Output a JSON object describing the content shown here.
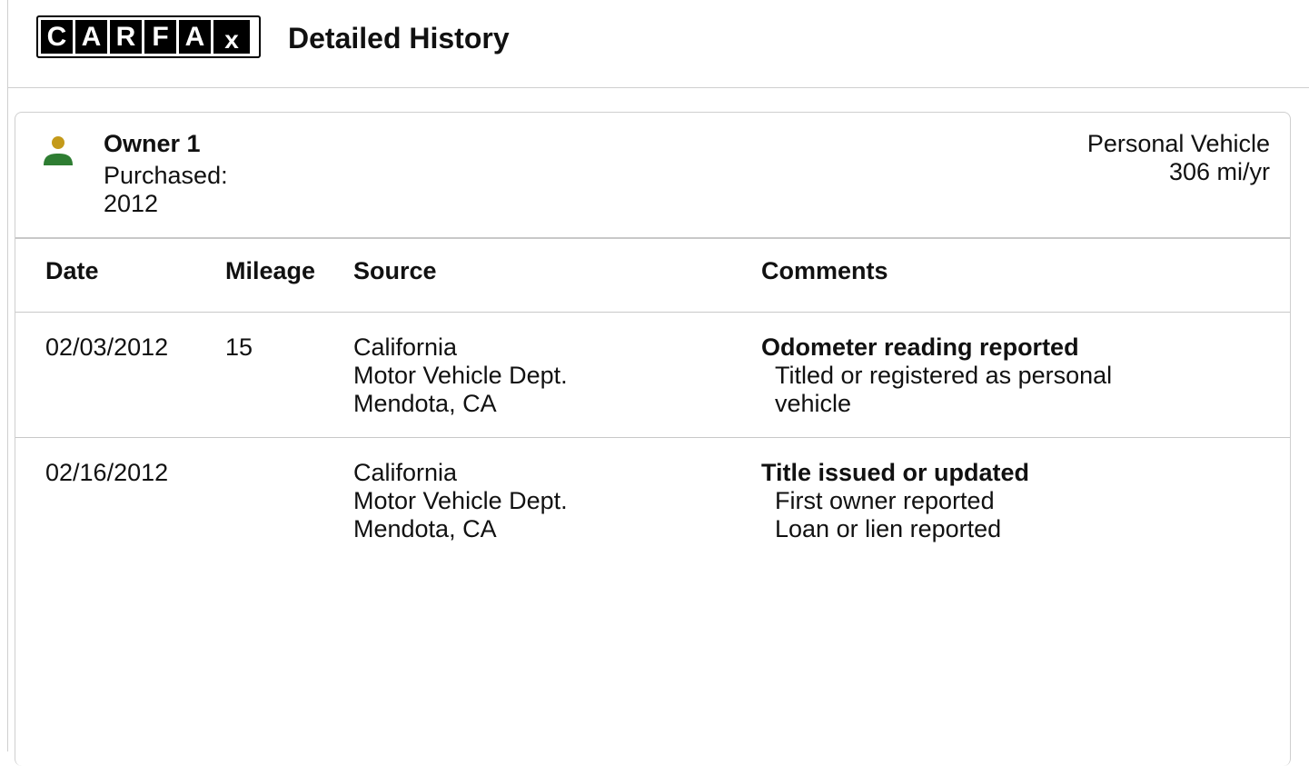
{
  "header": {
    "logo_letters": [
      "C",
      "A",
      "R",
      "F",
      "A",
      "X"
    ],
    "title": "Detailed History"
  },
  "owner": {
    "icon": "person-icon",
    "icon_head_color": "#c49a1a",
    "icon_body_color": "#2e7d32",
    "name": "Owner 1",
    "purchased_label": "Purchased:",
    "purchased_year": "2012",
    "vehicle_type": "Personal Vehicle",
    "mileage_per_year": "306 mi/yr"
  },
  "table": {
    "headers": {
      "date": "Date",
      "mileage": "Mileage",
      "source": "Source",
      "comments": "Comments"
    },
    "rows": [
      {
        "date": "02/03/2012",
        "mileage": "15",
        "source": [
          "California",
          "Motor Vehicle Dept.",
          "Mendota, CA"
        ],
        "comment_title": "Odometer reading reported",
        "comment_lines": [
          "Titled or registered as personal",
          "vehicle"
        ]
      },
      {
        "date": "02/16/2012",
        "mileage": "",
        "source": [
          "California",
          "Motor Vehicle Dept.",
          "Mendota, CA"
        ],
        "comment_title": "Title issued or updated",
        "comment_lines": [
          "First owner reported",
          "Loan or lien reported"
        ]
      }
    ]
  }
}
